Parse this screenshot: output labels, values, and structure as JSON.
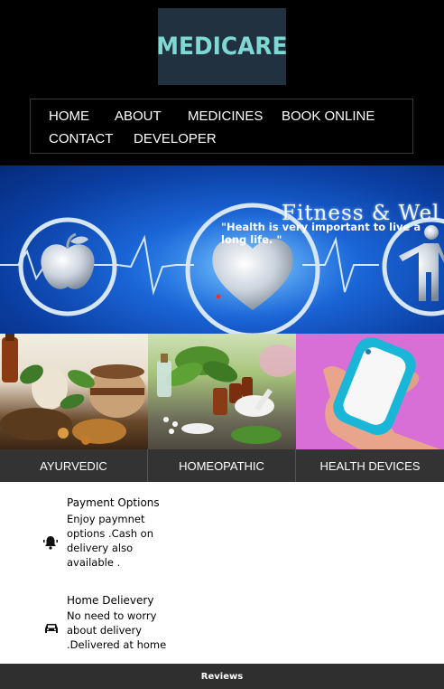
{
  "logo": {
    "text": "MEDICARE"
  },
  "nav": {
    "items": [
      "HOME",
      "ABOUT",
      "MEDICINES",
      "BOOK ONLINE",
      "CONTACT",
      "DEVELOPER"
    ]
  },
  "banner": {
    "title": "Fitness & Wel",
    "quote": "\"Health is very important to live a long life. \""
  },
  "categories": [
    {
      "label": "AYURVEDIC"
    },
    {
      "label": "HOMEOPATHIC"
    },
    {
      "label": "HEALTH DEVICES"
    }
  ],
  "features": [
    {
      "title": "Payment Options",
      "text": "Enjoy paymnet options .Cash on delivery also available .",
      "icon": "bell-icon"
    },
    {
      "title": "Home Delievery",
      "text": "No need to worry about delivery .Delivered at home",
      "icon": "car-icon"
    }
  ],
  "footer": {
    "label": "Reviews"
  },
  "colors": {
    "header_bg": "#000000",
    "logo_bg": "#22313f",
    "logo_text": "#7fd8d4",
    "label_bg": "#333333",
    "footer_bg": "#2f2f2f",
    "banner_blue": "#1a64d6"
  }
}
